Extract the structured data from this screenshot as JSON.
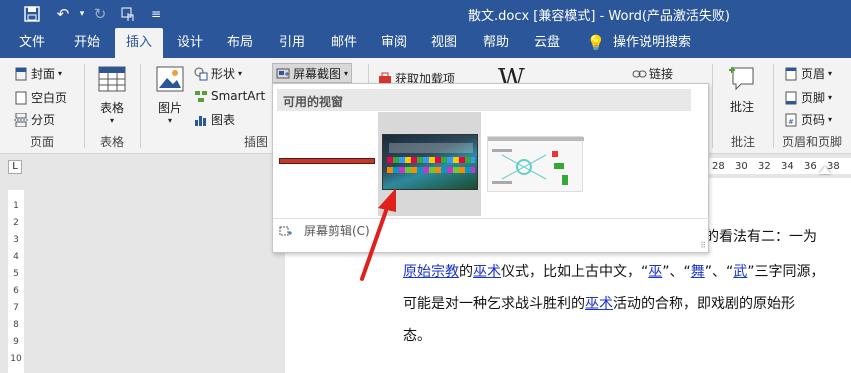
{
  "titlebar": {
    "title": "散文.docx [兼容模式]  -  Word(产品激活失败)",
    "qat": [
      {
        "name": "save-icon",
        "glyph": "💾"
      },
      {
        "name": "undo-icon",
        "glyph": "↶"
      },
      {
        "name": "redo-icon",
        "glyph": "↻"
      },
      {
        "name": "touch-mode-icon",
        "glyph": "☝"
      },
      {
        "name": "customize-qat-icon",
        "glyph": "≡"
      }
    ]
  },
  "tabs": [
    "文件",
    "开始",
    "插入",
    "设计",
    "布局",
    "引用",
    "邮件",
    "审阅",
    "视图",
    "帮助",
    "云盘",
    "操作说明搜索"
  ],
  "active_tab": "插入",
  "ribbon": {
    "pages": {
      "cover": "封面",
      "blank": "空白页",
      "break": "分页",
      "label": "页面"
    },
    "table": {
      "button": "表格",
      "label": "表格"
    },
    "illustrations": {
      "picture": "图片",
      "shapes": "形状",
      "smartart": "SmartArt",
      "chart": "图表",
      "screenshot": "屏幕截图",
      "label": "插图"
    },
    "addins": {
      "get": "获取加载项"
    },
    "links": {
      "link": "链接"
    },
    "comments": {
      "button": "批注",
      "label": "批注"
    },
    "header_footer": {
      "header": "页眉",
      "footer": "页脚",
      "page_number": "页码",
      "label": "页眉和页脚"
    }
  },
  "ruler": {
    "ticks": [
      "28",
      "30",
      "32",
      "34",
      "36",
      "38"
    ],
    "tab_selector": "L"
  },
  "vertical_ruler": [
    "1",
    "2",
    "3",
    "4",
    "5",
    "6",
    "7",
    "8",
    "9",
    "10"
  ],
  "screenshot_menu": {
    "header": "可用的视窗",
    "clipping": "屏幕剪辑(C)"
  },
  "document": {
    "line1": "的看法有二：一为",
    "line2": {
      "parts": [
        "原始宗教",
        "的",
        "巫术",
        "仪式，比如上古中文，“",
        "巫",
        "”、“",
        "舞",
        "”、“",
        "武",
        "”三字同源，"
      ]
    },
    "line3": {
      "parts": [
        "可能是对一种乞求战斗胜利的",
        "巫术",
        "活动的合称，即戏剧的原始形"
      ]
    },
    "line4": "态。"
  },
  "colors": {
    "accent": "#2b579a",
    "link": "#1a33cc",
    "arrow": "#e0201a"
  }
}
